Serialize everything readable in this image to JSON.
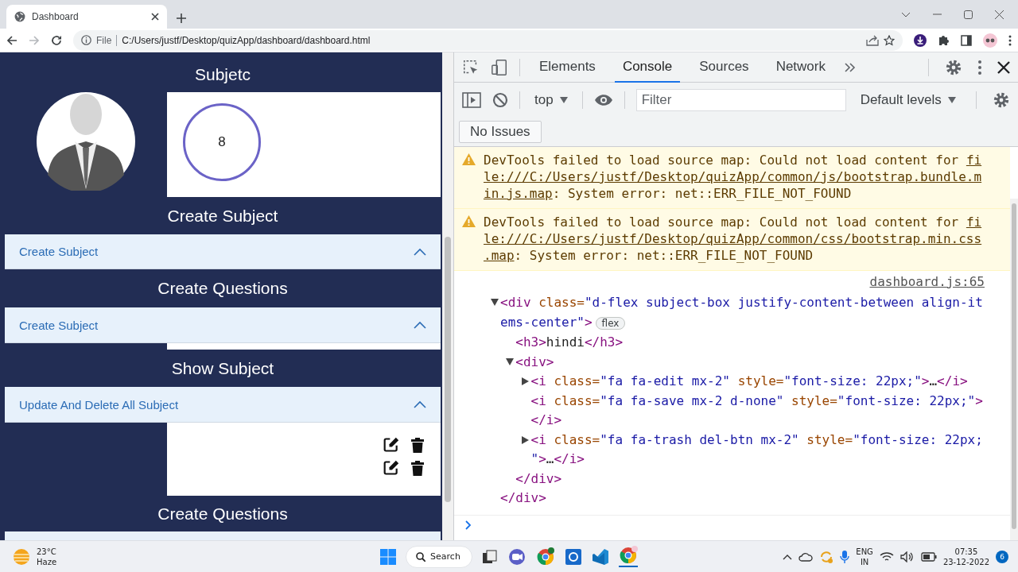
{
  "browser": {
    "tab": {
      "title": "Dashboard"
    },
    "address": {
      "scheme": "File",
      "url": "C:/Users/justf/Desktop/quizApp/dashboard/dashboard.html"
    }
  },
  "page": {
    "header": "Subjetc",
    "counter": "8",
    "sections": [
      {
        "kind": "band",
        "title": "Create Subject"
      },
      {
        "kind": "accordion",
        "title": "Create Subject",
        "expanded": true
      },
      {
        "kind": "band",
        "title": "Create Questions"
      },
      {
        "kind": "accordion",
        "title": "Create Subject",
        "expanded": true
      },
      {
        "kind": "gap"
      },
      {
        "kind": "band",
        "title": "Show Subject"
      },
      {
        "kind": "accordion",
        "title": "Update And Delete All Subject",
        "expanded": true
      },
      {
        "kind": "list",
        "rows": [
          {
            "kind": "actions"
          },
          {
            "kind": "actions"
          }
        ]
      },
      {
        "kind": "band",
        "title": "Create Questions"
      }
    ]
  },
  "devtools": {
    "tabs": [
      {
        "label": "Elements",
        "selected": false
      },
      {
        "label": "Console",
        "selected": true
      },
      {
        "label": "Sources",
        "selected": false
      },
      {
        "label": "Network",
        "selected": false
      }
    ],
    "context": "top",
    "filter_placeholder": "Filter",
    "levels": "Default levels",
    "issues": "No Issues",
    "messages": [
      {
        "kind": "warning",
        "before": "DevTools failed to load source map: Could not load content for ",
        "link": "file:///C:/Users/justf/Desktop/quizApp/common/js/bootstrap.bundle.min.js.map",
        "after": ": System error: net::ERR_FILE_NOT_FOUND"
      },
      {
        "kind": "warning",
        "before": "DevTools failed to load source map: Could not load content for ",
        "link": "file:///C:/Users/justf/Desktop/quizApp/common/css/bootstrap.min.css.map",
        "after": ": System error: net::ERR_FILE_NOT_FOUND"
      }
    ],
    "log": {
      "source": "dashboard.js:65",
      "tree": [
        {
          "expanded": true,
          "badge": "flex",
          "tokens": [
            {
              "kind": "tag",
              "text": "<div"
            },
            {
              "kind": "attr",
              "text": " class="
            },
            {
              "kind": "value",
              "text": "\"d-flex subject-box justify-content-between align-items-center\""
            },
            {
              "kind": "tag",
              "text": ">"
            }
          ],
          "children": [
            {
              "tokens": [
                {
                  "kind": "tag",
                  "text": "<h3>"
                },
                {
                  "kind": "text",
                  "text": "hindi"
                },
                {
                  "kind": "tag",
                  "text": "</h3>"
                }
              ]
            },
            {
              "expanded": true,
              "tokens": [
                {
                  "kind": "tag",
                  "text": "<div>"
                }
              ],
              "children": [
                {
                  "expanded": false,
                  "tokens": [
                    {
                      "kind": "tag",
                      "text": "<i"
                    },
                    {
                      "kind": "attr",
                      "text": " class="
                    },
                    {
                      "kind": "value",
                      "text": "\"fa fa-edit mx-2\""
                    },
                    {
                      "kind": "attr",
                      "text": " style="
                    },
                    {
                      "kind": "value",
                      "text": "\"font-size: 22px;\""
                    },
                    {
                      "kind": "tag",
                      "text": ">"
                    },
                    {
                      "kind": "text",
                      "text": "…"
                    },
                    {
                      "kind": "tag",
                      "text": "</i>"
                    }
                  ]
                },
                {
                  "tokens": [
                    {
                      "kind": "tag",
                      "text": "<i"
                    },
                    {
                      "kind": "attr",
                      "text": " class="
                    },
                    {
                      "kind": "value",
                      "text": "\"fa fa-save mx-2 d-none\""
                    },
                    {
                      "kind": "attr",
                      "text": " style="
                    },
                    {
                      "kind": "value",
                      "text": "\"font-size: 22px;\""
                    },
                    {
                      "kind": "tag",
                      "text": "></i>"
                    }
                  ]
                },
                {
                  "expanded": false,
                  "tokens": [
                    {
                      "kind": "tag",
                      "text": "<i"
                    },
                    {
                      "kind": "attr",
                      "text": " class="
                    },
                    {
                      "kind": "value",
                      "text": "\"fa fa-trash del-btn mx-2\""
                    },
                    {
                      "kind": "attr",
                      "text": " style="
                    },
                    {
                      "kind": "value",
                      "text": "\"font-size: 22px;\""
                    },
                    {
                      "kind": "tag",
                      "text": ">"
                    },
                    {
                      "kind": "text",
                      "text": "…"
                    },
                    {
                      "kind": "tag",
                      "text": "</i>"
                    }
                  ]
                }
              ],
              "closing": [
                {
                  "kind": "tag",
                  "text": "</div>"
                }
              ]
            }
          ],
          "closing": [
            {
              "kind": "tag",
              "text": "</div>"
            }
          ]
        }
      ]
    }
  },
  "taskbar": {
    "weather": {
      "temperature": "23°C",
      "condition": "Haze"
    },
    "search": "Search",
    "language": {
      "code": "ENG",
      "region": "IN"
    },
    "time": "07:35",
    "date": "23-12-2022",
    "notifications": "6"
  }
}
